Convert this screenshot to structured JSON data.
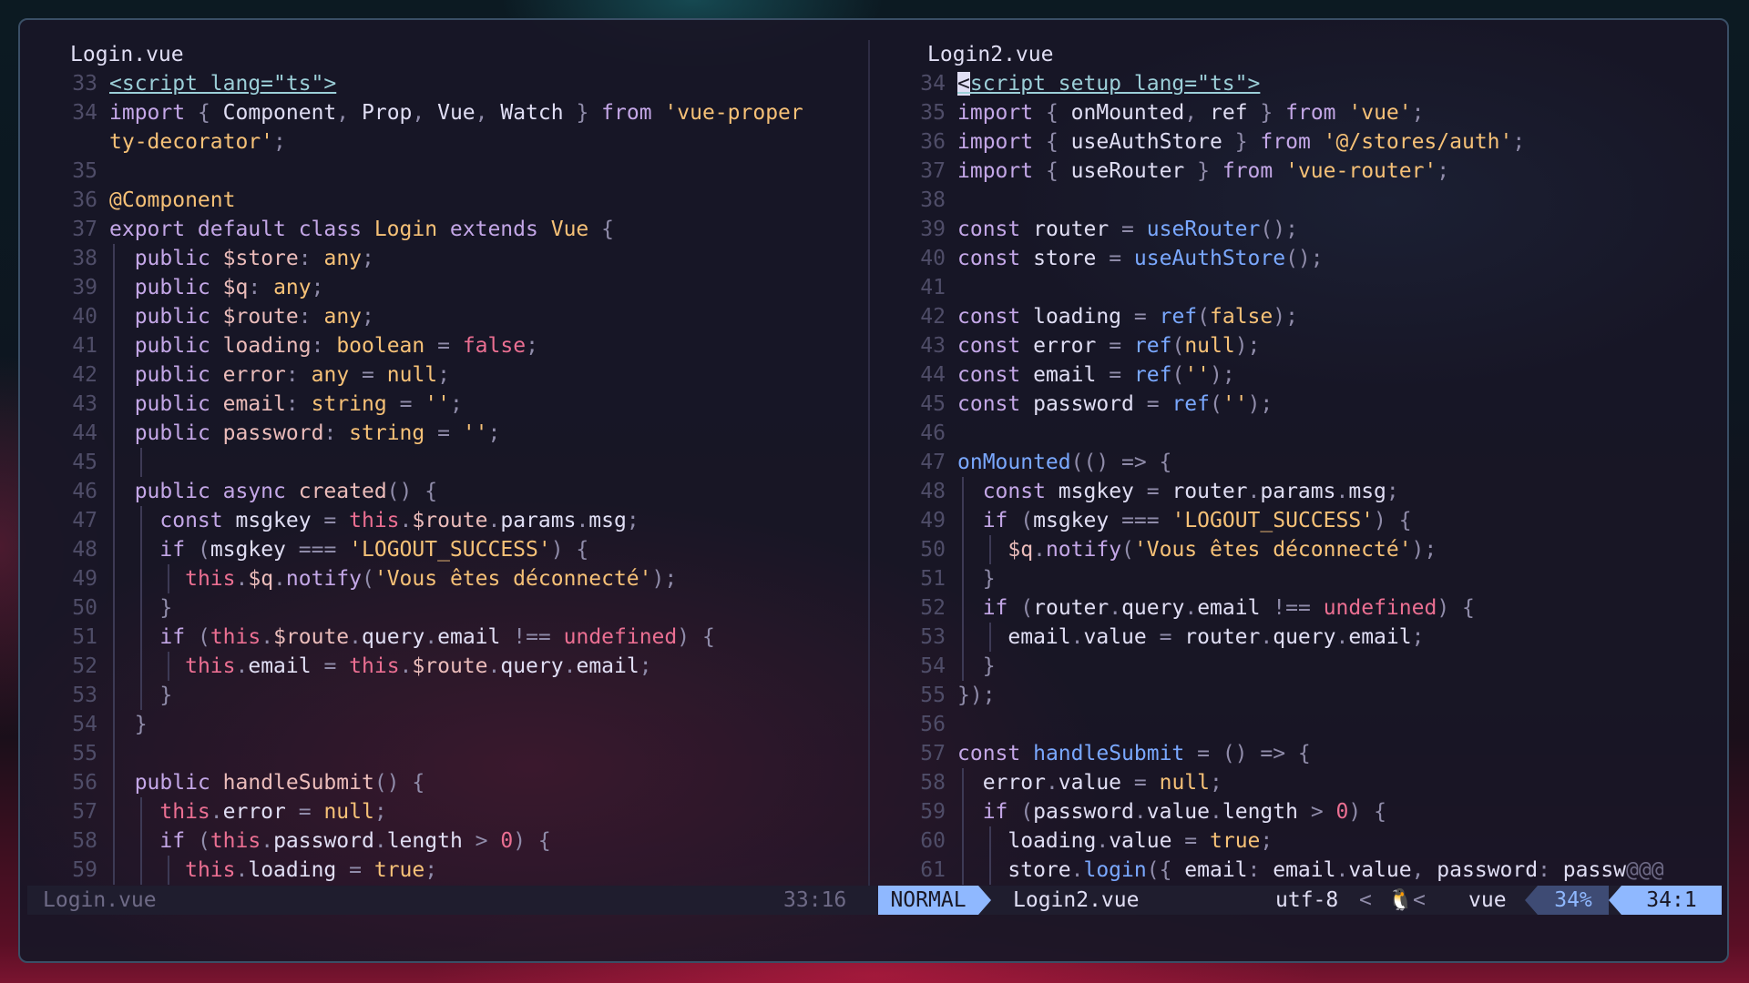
{
  "left_pane": {
    "title": "Login.vue",
    "lines": [
      {
        "n": "33"
      },
      {
        "n": "34"
      },
      {
        "n": ""
      },
      {
        "n": "35"
      },
      {
        "n": "36"
      },
      {
        "n": "37"
      },
      {
        "n": "38"
      },
      {
        "n": "39"
      },
      {
        "n": "40"
      },
      {
        "n": "41"
      },
      {
        "n": "42"
      },
      {
        "n": "43"
      },
      {
        "n": "44"
      },
      {
        "n": "45"
      },
      {
        "n": "46"
      },
      {
        "n": "47"
      },
      {
        "n": "48"
      },
      {
        "n": "49"
      },
      {
        "n": "50"
      },
      {
        "n": "51"
      },
      {
        "n": "52"
      },
      {
        "n": "53"
      },
      {
        "n": "54"
      },
      {
        "n": "55"
      },
      {
        "n": "56"
      },
      {
        "n": "57"
      },
      {
        "n": "58"
      },
      {
        "n": "59"
      }
    ]
  },
  "right_pane": {
    "title": "Login2.vue",
    "lines": [
      {
        "n": "34"
      },
      {
        "n": "35"
      },
      {
        "n": "36"
      },
      {
        "n": "37"
      },
      {
        "n": "38"
      },
      {
        "n": "39"
      },
      {
        "n": "40"
      },
      {
        "n": "41"
      },
      {
        "n": "42"
      },
      {
        "n": "43"
      },
      {
        "n": "44"
      },
      {
        "n": "45"
      },
      {
        "n": "46"
      },
      {
        "n": "47"
      },
      {
        "n": "48"
      },
      {
        "n": "49"
      },
      {
        "n": "50"
      },
      {
        "n": "51"
      },
      {
        "n": "52"
      },
      {
        "n": "53"
      },
      {
        "n": "54"
      },
      {
        "n": "55"
      },
      {
        "n": "56"
      },
      {
        "n": "57"
      },
      {
        "n": "58"
      },
      {
        "n": "59"
      },
      {
        "n": "60"
      },
      {
        "n": "61"
      }
    ]
  },
  "status": {
    "inactive_file": "Login.vue",
    "inactive_position": "33:16",
    "mode": "NORMAL",
    "active_file": "Login2.vue",
    "encoding": "utf-8",
    "separator": "<",
    "os_icon": "linux-tux-icon",
    "os_glyph": "🐧",
    "filetype": "vue",
    "percent": "34%",
    "position": "34:1"
  },
  "colors": {
    "mode_bg": "#8fb8ff",
    "keyword": "#c4a7e7",
    "string": "#f6c177",
    "type": "#9ccfd8",
    "boolean": "#eb6f92",
    "function_call": "#7aa8ff"
  }
}
